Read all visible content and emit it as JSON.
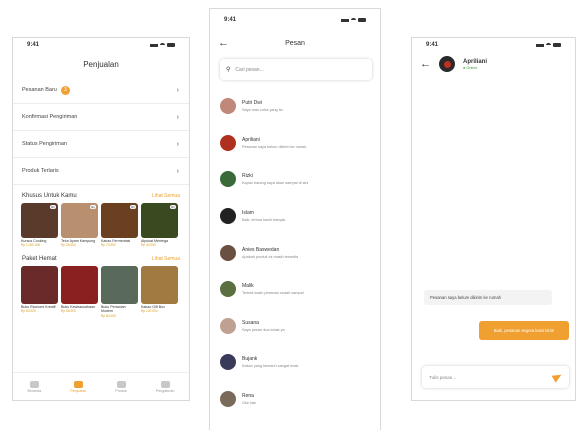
{
  "sales": {
    "time": "9:41",
    "title": "Penjualan",
    "menu": [
      {
        "label": "Pesanan Baru",
        "badge": "3"
      },
      {
        "label": "Konfirmasi Pengiriman",
        "badge": ""
      },
      {
        "label": "Status Pengiriman",
        "badge": ""
      },
      {
        "label": "Produk Terlaris",
        "badge": ""
      }
    ],
    "section1": {
      "title": "Khusus Untuk Kamu",
      "link": "Lihat Semua"
    },
    "products1": [
      {
        "name": "Kursus Cooking",
        "price": "Rp 1.000.000",
        "color": "#5a3a2a",
        "tag": "Rp"
      },
      {
        "name": "Telur Ayam Kampung",
        "price": "Rp 25.000",
        "color": "#b89070",
        "tag": "Rp"
      },
      {
        "name": "Kakao Fermentasi",
        "price": "Rp 70.000",
        "color": "#6a4020",
        "tag": "Rp"
      },
      {
        "name": "Alpukat Mentega",
        "price": "Rp 40.000",
        "color": "#3a4a20",
        "tag": "Rp"
      }
    ],
    "section2": {
      "title": "Paket Hemat",
      "link": "Lihat Semua"
    },
    "products2": [
      {
        "name": "Buku Ekonomi Kreatif",
        "price": "Rp 60.000",
        "color": "#6a2a2a"
      },
      {
        "name": "Buku Kewirausahaan",
        "price": "Rp 65.000",
        "color": "#8a2020"
      },
      {
        "name": "Buku Pertanian Modern",
        "price": "Rp 80.000",
        "color": "#5a6a5a"
      },
      {
        "name": "Kakao Gift Box",
        "price": "Rp 120.000",
        "color": "#a07a40"
      }
    ],
    "nav": [
      {
        "label": "Beranda",
        "active": false
      },
      {
        "label": "Penjualan",
        "active": true
      },
      {
        "label": "Produk",
        "active": false
      },
      {
        "label": "Pengaturan",
        "active": false
      }
    ]
  },
  "messages": {
    "time": "9:41",
    "title": "Pesan",
    "search_placeholder": "Cari pesan...",
    "chats": [
      {
        "name": "Putri Dwi",
        "msg": "Saya mau coba yang itu",
        "color": "#c08878"
      },
      {
        "name": "Apriliani",
        "msg": "Pesanan saya belum dikirim ke rumah",
        "color": "#b03020"
      },
      {
        "name": "Rizki",
        "msg": "Kapan barang saya akan sampai di sini",
        "color": "#3a6a3a"
      },
      {
        "name": "Islam",
        "msg": "Baik, terima kasih banyak",
        "color": "#222222"
      },
      {
        "name": "Anies Baswedan",
        "msg": "Apakah produk ini masih tersedia",
        "color": "#6a5040"
      },
      {
        "name": "Malik",
        "msg": "Terima kasih pesanan sudah sampai",
        "color": "#5a7040"
      },
      {
        "name": "Susana",
        "msg": "Saya pesan dua kotak ya",
        "color": "#c0a090"
      },
      {
        "name": "Bujank",
        "msg": "Kakao yang kemarin sangat enak",
        "color": "#3a3a5a"
      },
      {
        "name": "Rena",
        "msg": "Oke kak",
        "color": "#7a6a5a"
      }
    ]
  },
  "chat": {
    "time": "9:41",
    "name": "Apriliani",
    "status": "Online",
    "incoming": "Pesanan saya belum dikirim ke rumah",
    "outgoing": "Baik, pesanan segera kami kirim",
    "input_placeholder": "Tulis pesan..."
  }
}
